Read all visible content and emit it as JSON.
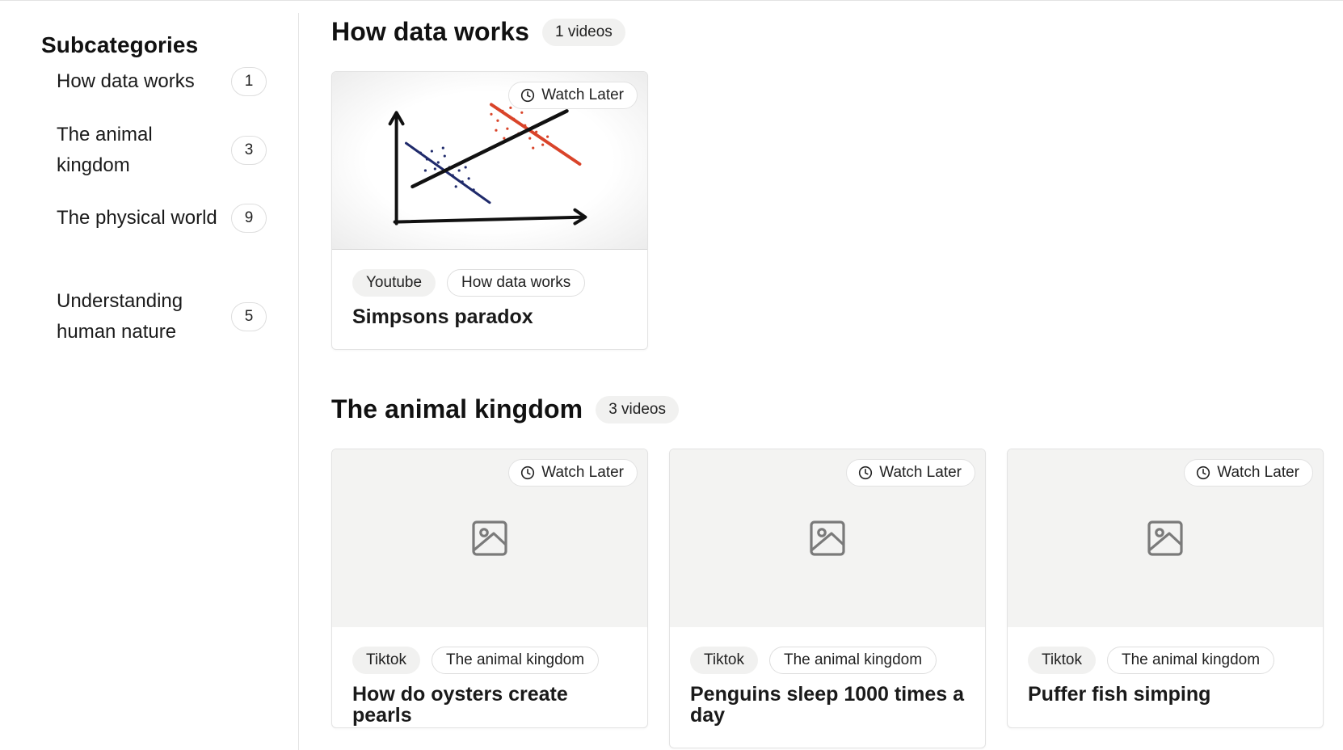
{
  "sidebar": {
    "title": "Subcategories",
    "items": [
      {
        "label": "How data works",
        "count": "1"
      },
      {
        "label": "The animal kingdom",
        "count": "3"
      },
      {
        "label": "The physical world",
        "count": "9"
      },
      {
        "label": "Understanding human nature",
        "count": "5"
      }
    ]
  },
  "sections": [
    {
      "title": "How data works",
      "count_label": "1 videos",
      "cards": [
        {
          "watch_later": "Watch Later",
          "platform": "Youtube",
          "category": "How data works",
          "title": "Simpsons paradox",
          "thumbnail": "scatter-chart-drawing"
        }
      ]
    },
    {
      "title": "The animal kingdom",
      "count_label": "3 videos",
      "cards": [
        {
          "watch_later": "Watch Later",
          "platform": "Tiktok",
          "category": "The animal kingdom",
          "title": "How do oysters create pearls",
          "thumbnail": "image-placeholder-icon"
        },
        {
          "watch_later": "Watch Later",
          "platform": "Tiktok",
          "category": "The animal kingdom",
          "title": "Penguins sleep 1000 times a day",
          "thumbnail": "image-placeholder-icon"
        },
        {
          "watch_later": "Watch Later",
          "platform": "Tiktok",
          "category": "The animal kingdom",
          "title": "Puffer fish simping",
          "thumbnail": "image-placeholder-icon"
        }
      ]
    }
  ],
  "icons": {
    "watch_later": "clock-icon",
    "placeholder": "image-placeholder-icon"
  },
  "colors": {
    "tag_bg": "#f1f1f0",
    "border": "#e3e3e3",
    "chart_blue": "#1f2a6b",
    "chart_red": "#d9442a"
  }
}
